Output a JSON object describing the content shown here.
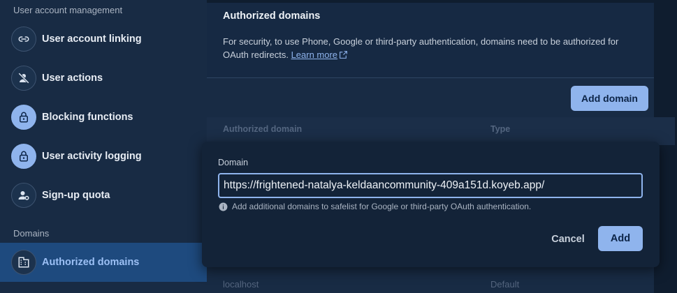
{
  "sidebar": {
    "section_user_account": "User account management",
    "section_domains": "Domains",
    "items": [
      {
        "label": "User account linking",
        "icon": "link-icon"
      },
      {
        "label": "User actions",
        "icon": "person-off-icon"
      },
      {
        "label": "Blocking functions",
        "icon": "lock-icon"
      },
      {
        "label": "User activity logging",
        "icon": "lock-icon"
      },
      {
        "label": "Sign-up quota",
        "icon": "person-settings-icon"
      },
      {
        "label": "Authorized domains",
        "icon": "domain-icon",
        "active": true
      }
    ]
  },
  "header": {
    "title": "Authorized domains",
    "description": "For security, to use Phone, Google or third-party authentication, domains need to be authorized for OAuth redirects.",
    "learn_more": "Learn more"
  },
  "toolbar": {
    "add_domain_label": "Add domain"
  },
  "table": {
    "columns": [
      "Authorized domain",
      "Type"
    ],
    "rows": [
      {
        "domain": "localhost",
        "type": "Default"
      }
    ]
  },
  "dialog": {
    "field_label": "Domain",
    "field_value": "https://frightened-natalya-keldaancommunity-409a151d.koyeb.app/",
    "hint": "Add additional domains to safelist for Google or third-party OAuth authentication.",
    "cancel_label": "Cancel",
    "add_label": "Add"
  },
  "colors": {
    "accent": "#8fb4ed",
    "sidebar_bg": "#182b44",
    "active_item_bg": "#1e4a7e",
    "dialog_bg": "#132338"
  }
}
